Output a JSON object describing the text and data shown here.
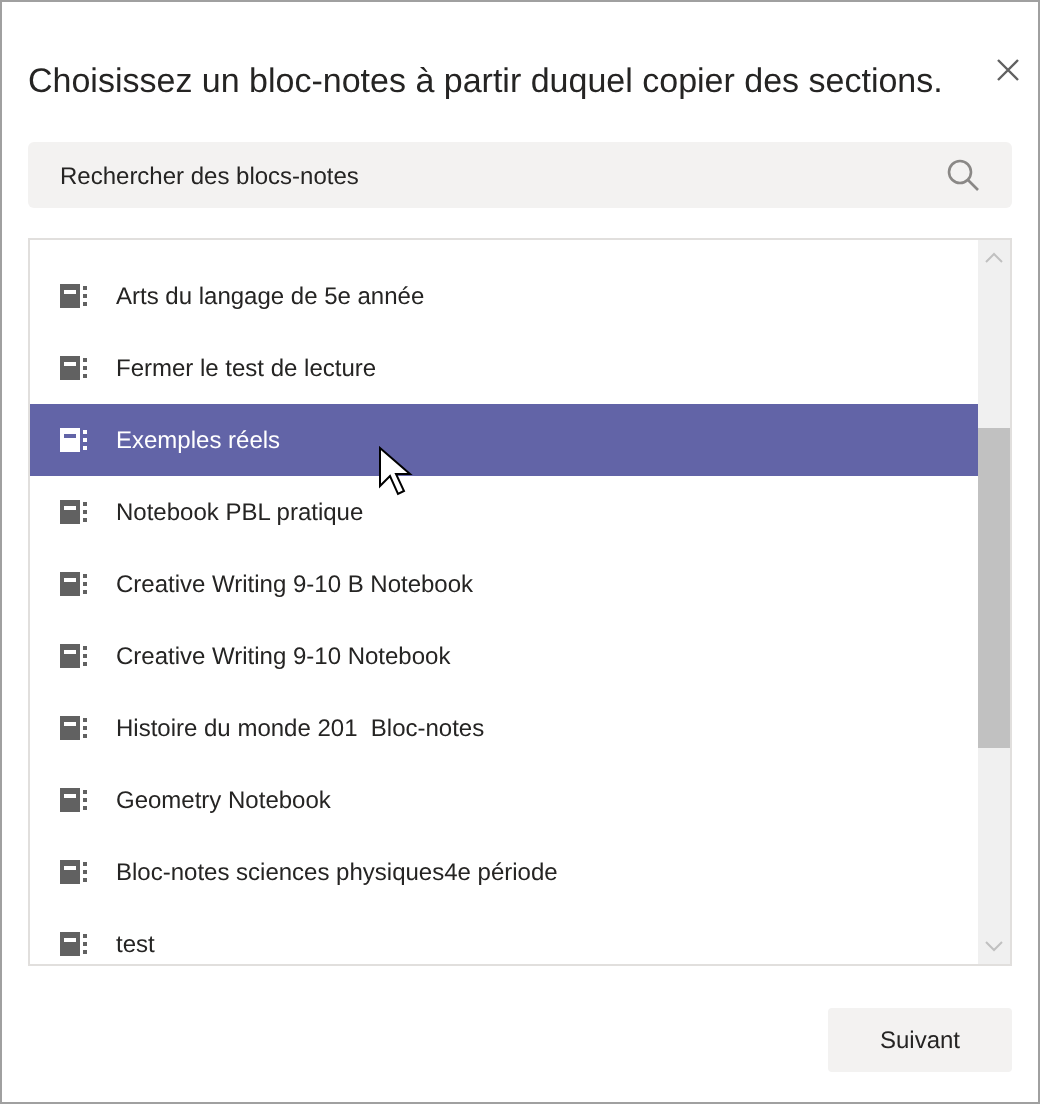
{
  "dialog": {
    "title": "Choisissez un bloc-notes à partir duquel copier des sections.",
    "search": {
      "placeholder": "Rechercher des blocs-notes"
    },
    "notebooks": [
      {
        "label": "Arts du langage de 5e année",
        "selected": false
      },
      {
        "label": "Fermer le test de lecture",
        "selected": false
      },
      {
        "label": "Exemples réels",
        "selected": true
      },
      {
        "label": "Notebook PBL pratique",
        "selected": false
      },
      {
        "label": "Creative Writing 9-10 B Notebook",
        "selected": false
      },
      {
        "label": "Creative Writing 9-10 Notebook",
        "selected": false
      },
      {
        "label": "Histoire du monde 201  Bloc-notes",
        "selected": false
      },
      {
        "label": "Geometry Notebook",
        "selected": false
      },
      {
        "label": "Bloc-notes sciences physiques4e période",
        "selected": false
      },
      {
        "label": "test",
        "selected": false
      }
    ],
    "buttons": [
      "Suivant"
    ]
  }
}
